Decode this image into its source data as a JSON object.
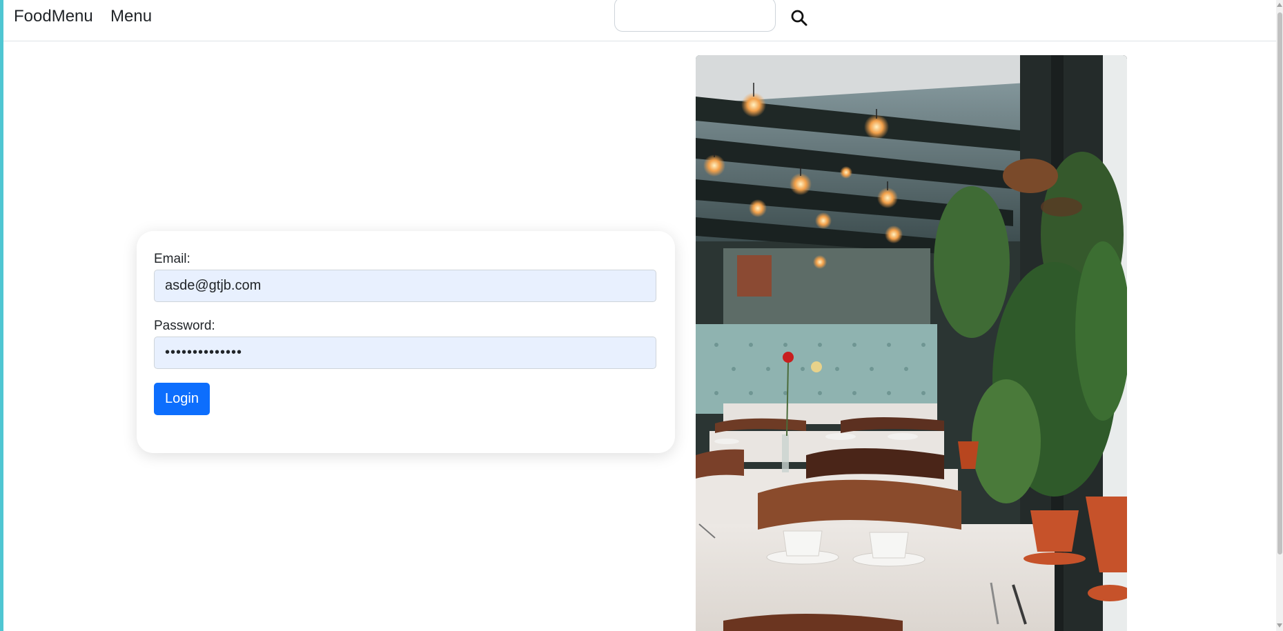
{
  "navbar": {
    "brand": "FoodMenu",
    "menu_link": "Menu",
    "search": {
      "value": "",
      "placeholder": ""
    },
    "search_icon": "search-icon"
  },
  "login_form": {
    "email_label": "Email:",
    "email_value": "asde@gtjb.com",
    "password_label": "Password:",
    "password_value": "••••••••••••••",
    "login_button": "Login"
  },
  "colors": {
    "primary_button": "#0d6efd",
    "autofill_input_bg": "#e8f0fe",
    "left_accent": "#4fc6d2"
  }
}
